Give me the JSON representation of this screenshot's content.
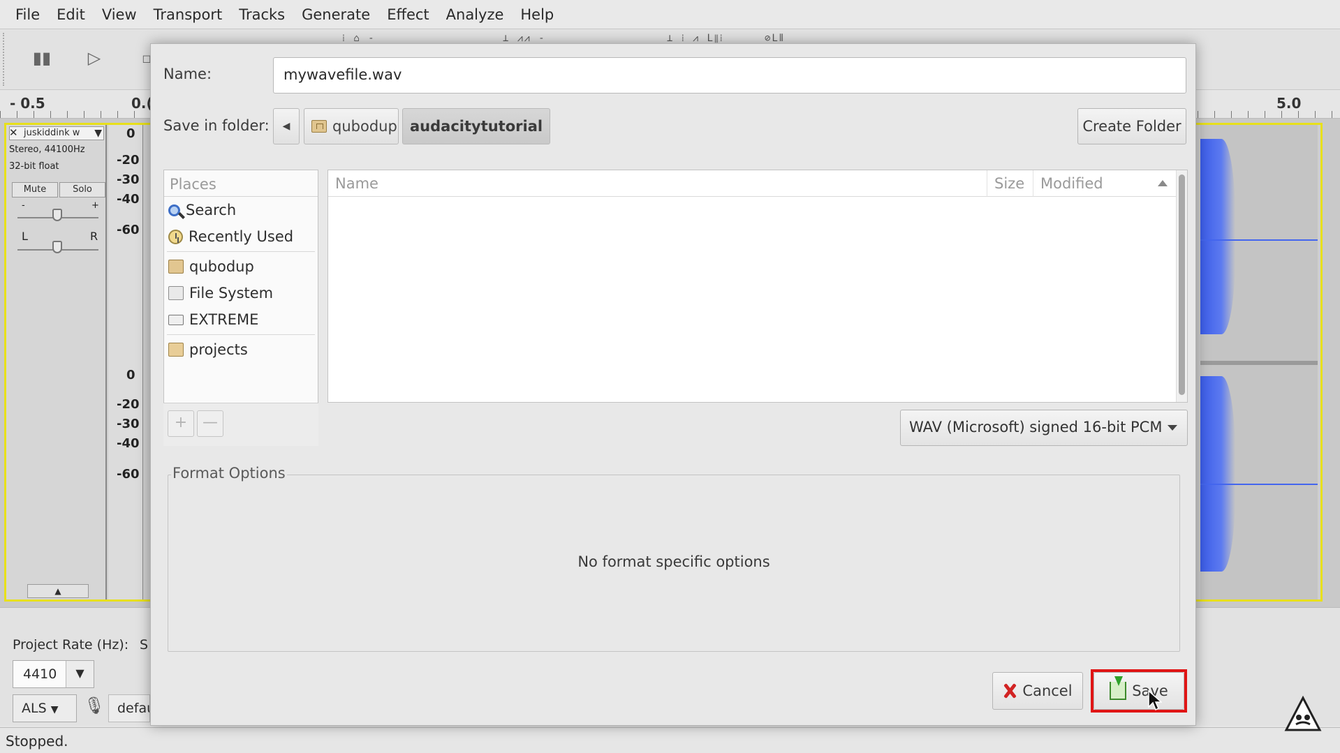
{
  "menubar": {
    "items": [
      "File",
      "Edit",
      "View",
      "Transport",
      "Tracks",
      "Generate",
      "Effect",
      "Analyze",
      "Help"
    ]
  },
  "ruler": {
    "left_label": "- 0.5",
    "mid_label": "0.(",
    "right_label": "5.0"
  },
  "track": {
    "name": "juskiddink w",
    "format_line": "Stereo, 44100Hz",
    "bits_line": "32-bit float",
    "mute_label": "Mute",
    "solo_label": "Solo",
    "gain_minus": "-",
    "gain_plus": "+",
    "pan_left": "L",
    "pan_right": "R",
    "vruler_top": [
      "0",
      "-20",
      "-30",
      "-40",
      "-60"
    ],
    "vruler_bottom": [
      "0",
      "-20",
      "-30",
      "-40",
      "-60"
    ],
    "wave_color": "#3b5ce8",
    "selection_color": "#e8e01a"
  },
  "selection_bar": {
    "project_rate_label": "Project Rate (Hz):",
    "project_rate_value": "4410",
    "snap_fragment": "S",
    "audio_host": "ALS",
    "device": "defau"
  },
  "status": {
    "text": "Stopped."
  },
  "dialog": {
    "name_label": "Name:",
    "name_value": "mywavefile.wav",
    "folder_label": "Save in folder:",
    "breadcrumbs": [
      "qubodup",
      "audacitytutorial"
    ],
    "create_folder": "Create Folder",
    "places_header": "Places",
    "places": [
      {
        "label": "Search",
        "icon": "search-icon"
      },
      {
        "label": "Recently Used",
        "icon": "clock-icon"
      },
      {
        "label": "qubodup",
        "icon": "home-folder-icon"
      },
      {
        "label": "File System",
        "icon": "filesystem-icon"
      },
      {
        "label": "EXTREME",
        "icon": "drive-icon"
      },
      {
        "label": "projects",
        "icon": "folder-icon"
      }
    ],
    "places_add": "+",
    "places_remove": "—",
    "columns": {
      "name": "Name",
      "size": "Size",
      "modified": "Modified"
    },
    "file_type": "WAV (Microsoft) signed 16-bit PCM",
    "format_options_legend": "Format Options",
    "format_options_message": "No format specific options",
    "cancel": "Cancel",
    "save": "Save",
    "highlight_color": "#e01515"
  }
}
